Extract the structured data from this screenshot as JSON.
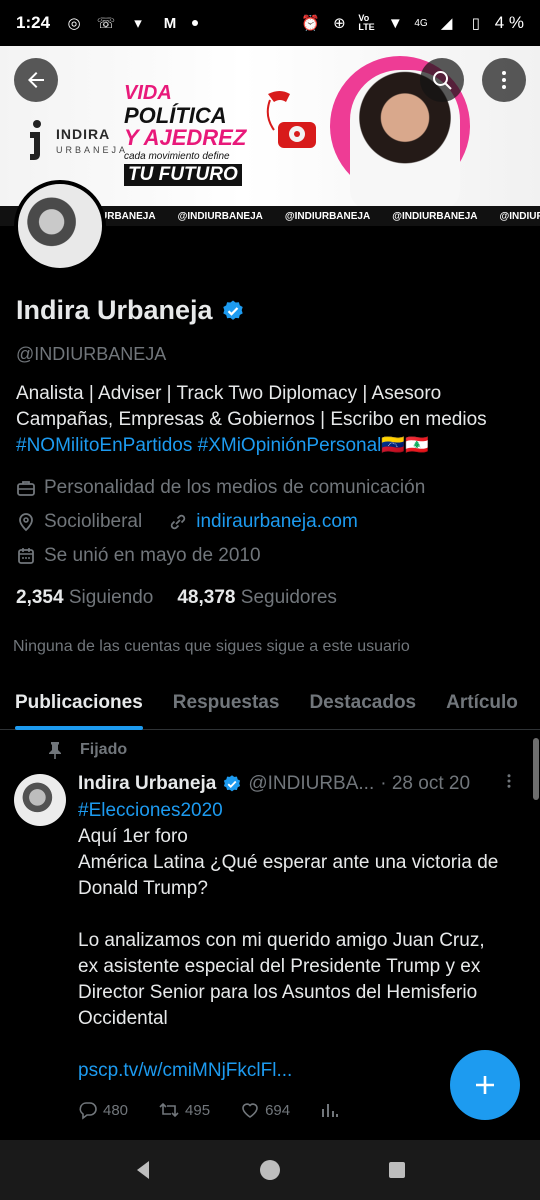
{
  "status_bar": {
    "time": "1:24",
    "lte_label": "Vo LTE",
    "network": "4G",
    "battery": "4 %"
  },
  "banner": {
    "logo_name": "INDIRA",
    "logo_sub": "URBANEJA",
    "headline_1": "VIDA",
    "headline_2": "POLÍTICA",
    "headline_3": "Y AJEDREZ",
    "headline_4": "cada movimiento define",
    "headline_5": "TU FUTURO",
    "strip_items": [
      "URBANEJA",
      "@INDIURBANEJA",
      "@INDIURBANEJA",
      "@INDIURBANEJA",
      "@INDIURBANEJA"
    ]
  },
  "profile": {
    "name": "Indira Urbaneja",
    "handle": "@INDIURBANEJA",
    "bio_line1": "Analista | Adviser | Track Two Diplomacy | Asesoro",
    "bio_line2": "Campañas, Empresas & Gobiernos | Escribo en medios",
    "bio_tags": "#NOMilitoEnPartidos #XMiOpiniónPersonal",
    "bio_flags": "🇻🇪🇱🇧",
    "category": "Personalidad de los medios de comunicación",
    "location": "Socioliberal",
    "website": "indiraurbaneja.com",
    "joined": "Se unió en mayo de 2010",
    "following_count": "2,354",
    "following_label": "Siguiendo",
    "followers_count": "48,378",
    "followers_label": "Seguidores",
    "no_known_followers": "Ninguna de las cuentas que sigues sigue a este usuario"
  },
  "tabs": [
    {
      "label": "Publicaciones",
      "active": true
    },
    {
      "label": "Respuestas",
      "active": false
    },
    {
      "label": "Destacados",
      "active": false
    },
    {
      "label": "Artículo",
      "active": false
    }
  ],
  "post": {
    "pinned_label": "Fijado",
    "author": "Indira Urbaneja",
    "handle": "@INDIURBA...",
    "date": "· 28 oct 20",
    "hashtag": "#Elecciones2020",
    "line1": "Aquí 1er foro",
    "line2": "América Latina ¿Qué esperar ante una victoria de",
    "line3": "Donald Trump?",
    "line4": "Lo analizamos con mi querido amigo Juan Cruz,",
    "line5": "ex asistente especial del Presidente Trump y ex",
    "line6": "Director Senior para los Asuntos del Hemisferio",
    "line7": "Occidental",
    "link": "pscp.tv/w/cmiMNjFkclFl...",
    "replies": "480",
    "reposts": "495",
    "likes": "694"
  },
  "colors": {
    "accent": "#1d9bf0",
    "secondary_text": "#71767b",
    "banner_pink": "#e8197a"
  }
}
